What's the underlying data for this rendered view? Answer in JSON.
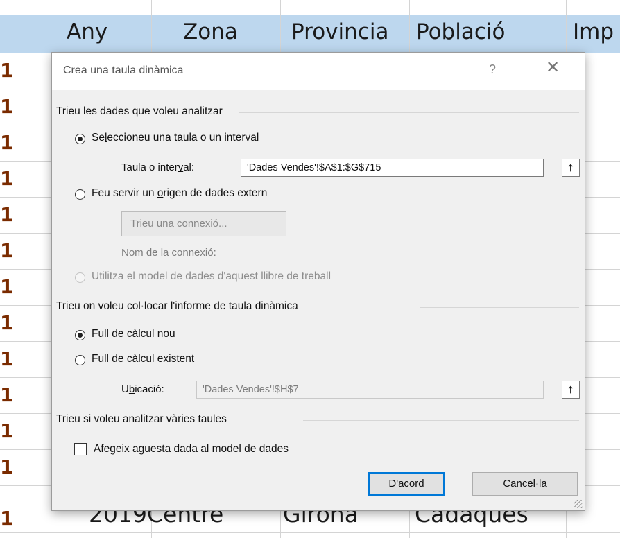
{
  "sheet": {
    "headers": [
      "Any",
      "Zona",
      "Provincia",
      "Població",
      "Imp"
    ],
    "row_marker": "1",
    "bottom_row": [
      "2019",
      "Centre",
      "Girona",
      "Cadaqués"
    ]
  },
  "dialog": {
    "title": "Crea una taula dinàmica",
    "help_glyph": "?",
    "close_glyph": "✕",
    "section1": "Trieu les dades que voleu analitzar",
    "opt_table": {
      "before": "Se",
      "u": "l",
      "after": "eccioneu una taula o un interval"
    },
    "range_label": {
      "before": "Taula o inter",
      "u": "v",
      "after": "al:"
    },
    "range_value": "'Dades Vendes'!$A$1:$G$715",
    "opt_external": {
      "before": "Feu servir un ",
      "u": "o",
      "after": "rigen de dades extern"
    },
    "choose_connection": "Trieu una connexió...",
    "connection_name_label": "Nom de la connexió:",
    "opt_data_model": "Utilitza el model de dades d'aquest llibre de treball",
    "section2": "Trieu on voleu col·locar l'informe de taula dinàmica",
    "opt_new_sheet": {
      "before": "Full de càlcul ",
      "u": "n",
      "after": "ou"
    },
    "opt_existing_sheet": {
      "before": "Full ",
      "u": "d",
      "after": "e càlcul existent"
    },
    "location_label": {
      "before": "U",
      "u": "b",
      "after": "icació:"
    },
    "location_value": "'Dades Vendes'!$H$7",
    "section3": "Trieu si voleu analitzar vàries taules",
    "add_to_model": {
      "before": "Afegeix a",
      "u": "g",
      "after": "uesta dada al model de dades"
    },
    "ok_button": "D'acord",
    "cancel_button": "Cancel·la",
    "picker_glyph": "⭡"
  }
}
